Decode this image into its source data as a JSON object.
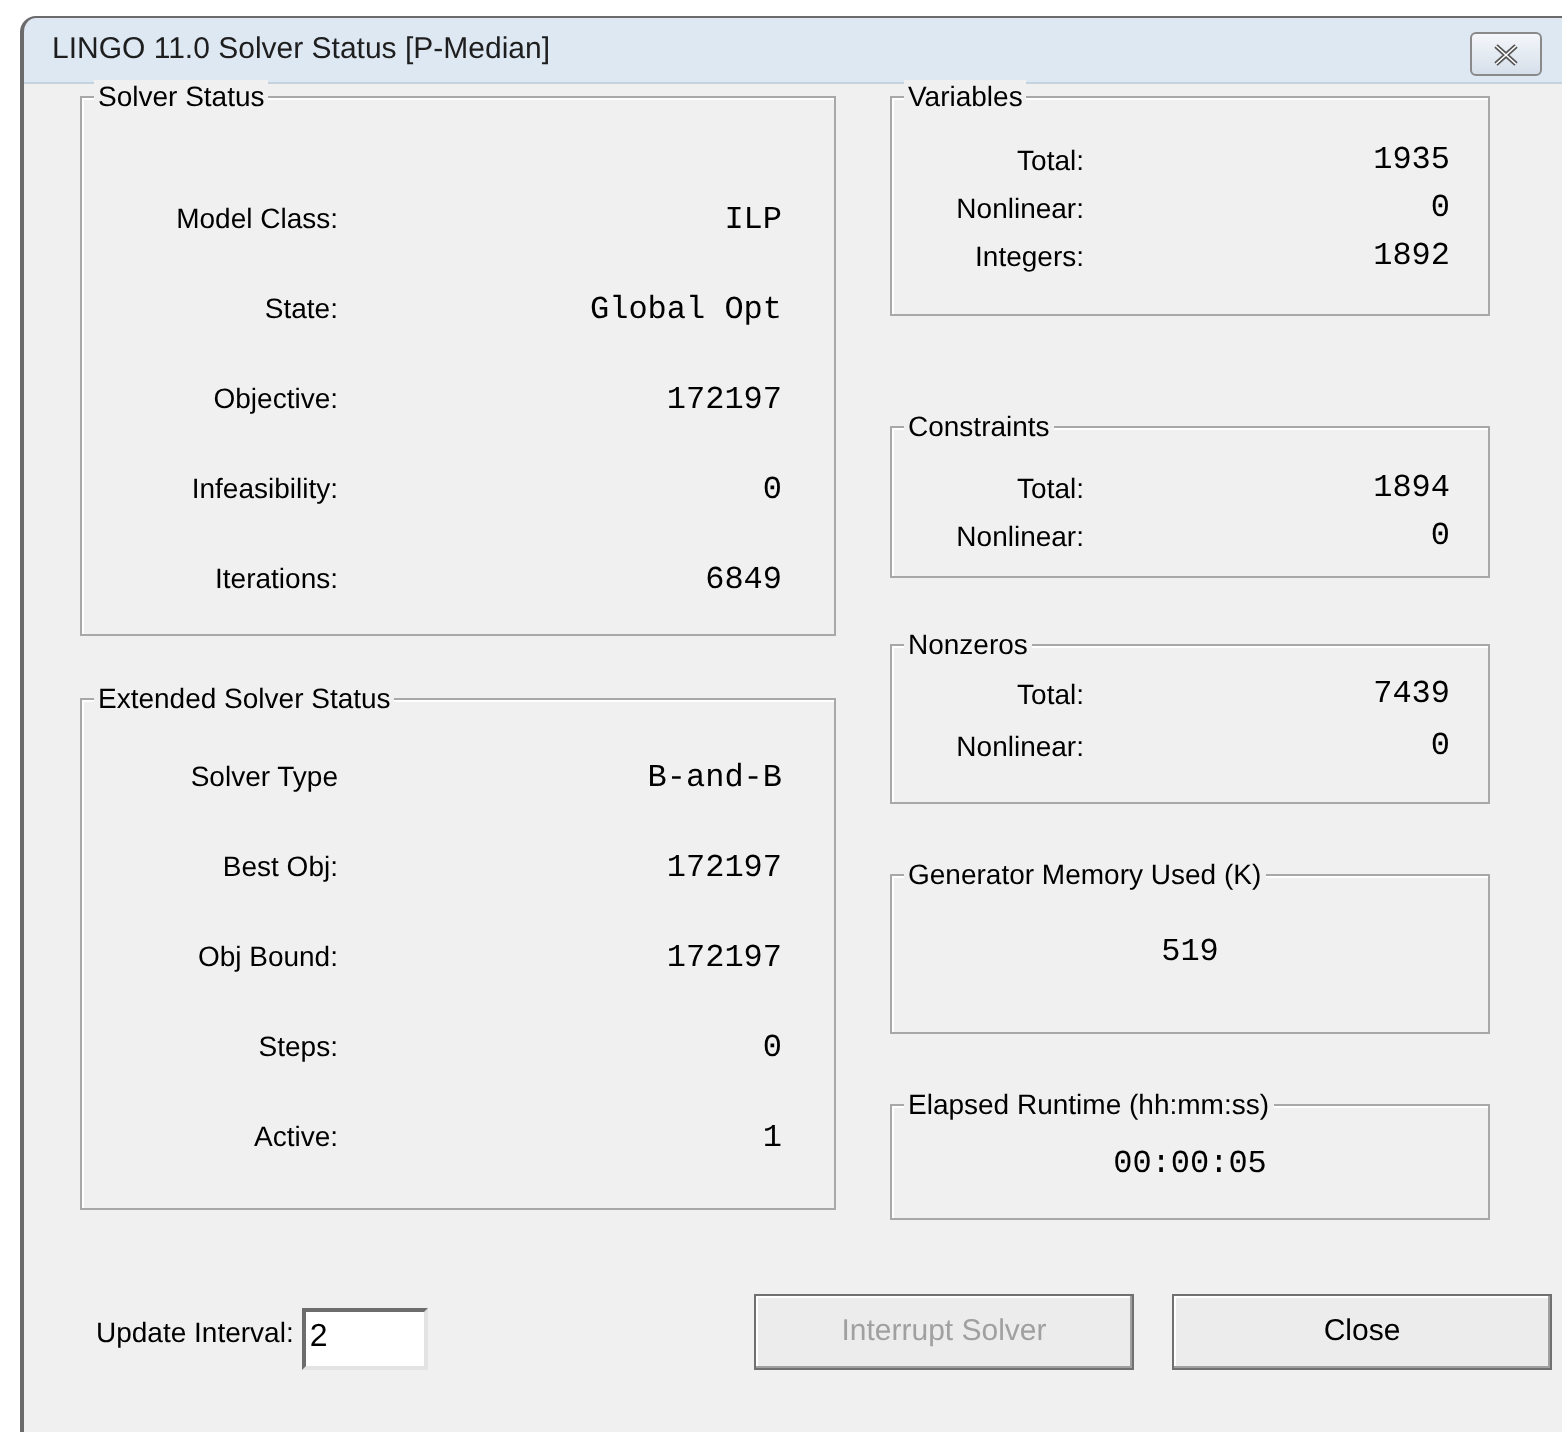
{
  "window": {
    "title": "LINGO 11.0 Solver Status [P-Median]"
  },
  "solver_status": {
    "title": "Solver Status",
    "rows": [
      {
        "label": "Model Class:",
        "value": "ILP"
      },
      {
        "label": "State:",
        "value": "Global Opt"
      },
      {
        "label": "Objective:",
        "value": "172197"
      },
      {
        "label": "Infeasibility:",
        "value": "0"
      },
      {
        "label": "Iterations:",
        "value": "6849"
      }
    ]
  },
  "extended_solver_status": {
    "title": "Extended Solver Status",
    "rows": [
      {
        "label": "Solver Type",
        "value": "B-and-B"
      },
      {
        "label": "Best Obj:",
        "value": "172197"
      },
      {
        "label": "Obj Bound:",
        "value": "172197"
      },
      {
        "label": "Steps:",
        "value": "0"
      },
      {
        "label": "Active:",
        "value": "1"
      }
    ]
  },
  "variables": {
    "title": "Variables",
    "rows": [
      {
        "label": "Total:",
        "value": "1935"
      },
      {
        "label": "Nonlinear:",
        "value": "0"
      },
      {
        "label": "Integers:",
        "value": "1892"
      }
    ]
  },
  "constraints": {
    "title": "Constraints",
    "rows": [
      {
        "label": "Total:",
        "value": "1894"
      },
      {
        "label": "Nonlinear:",
        "value": "0"
      }
    ]
  },
  "nonzeros": {
    "title": "Nonzeros",
    "rows": [
      {
        "label": "Total:",
        "value": "7439"
      },
      {
        "label": "Nonlinear:",
        "value": "0"
      }
    ]
  },
  "generator_memory": {
    "title": "Generator Memory Used (K)",
    "value": "519"
  },
  "elapsed_runtime": {
    "title": "Elapsed Runtime (hh:mm:ss)",
    "value": "00:00:05"
  },
  "update_interval": {
    "label": "Update Interval:",
    "value": "2"
  },
  "buttons": [
    {
      "label": "Interrupt Solver",
      "disabled": true
    },
    {
      "label": "Close",
      "disabled": false
    }
  ]
}
